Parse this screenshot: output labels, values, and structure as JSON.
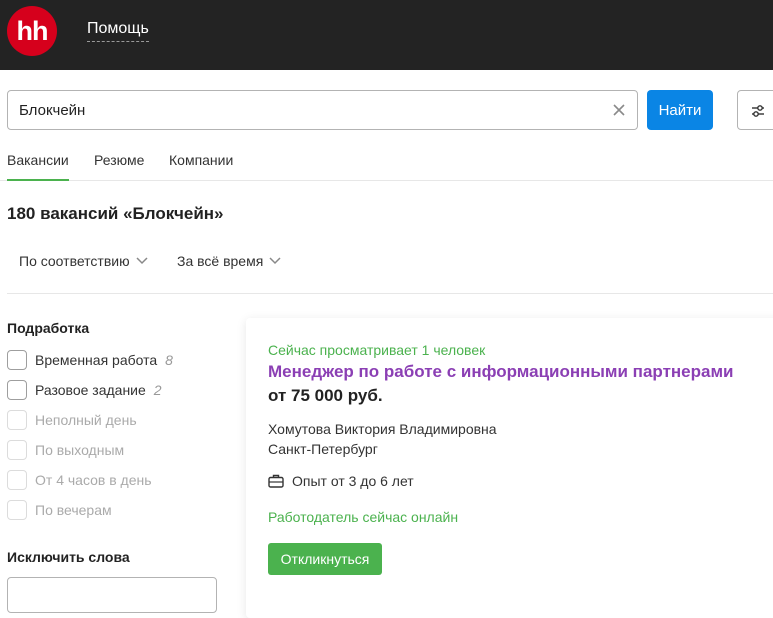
{
  "header": {
    "logo_text": "hh",
    "help_label": "Помощь"
  },
  "search": {
    "value": "Блокчейн",
    "button_label": "Найти"
  },
  "tabs": [
    {
      "label": "Вакансии",
      "active": true
    },
    {
      "label": "Резюме",
      "active": false
    },
    {
      "label": "Компании",
      "active": false
    }
  ],
  "results": {
    "title": "180 вакансий «Блокчейн»",
    "sort_label": "По соответствию",
    "period_label": "За всё время"
  },
  "sidebar": {
    "section_title": "Подработка",
    "options": [
      {
        "label": "Временная работа",
        "count": "8",
        "enabled": true
      },
      {
        "label": "Разовое задание",
        "count": "2",
        "enabled": true
      },
      {
        "label": "Неполный день",
        "count": "",
        "enabled": false
      },
      {
        "label": "По выходным",
        "count": "",
        "enabled": false
      },
      {
        "label": "От 4 часов в день",
        "count": "",
        "enabled": false
      },
      {
        "label": "По вечерам",
        "count": "",
        "enabled": false
      }
    ],
    "exclude_title": "Исключить слова"
  },
  "vacancy": {
    "viewing_now": "Сейчас просматривает 1 человек",
    "title": "Менеджер по работе с информационными партнерами",
    "salary": "от 75 000 руб.",
    "employer": "Хомутова Виктория Владимировна",
    "city": "Санкт-Петербург",
    "experience": "Опыт от 3 до 6 лет",
    "employer_online": "Работодатель сейчас онлайн",
    "apply_label": "Откликнуться"
  },
  "colors": {
    "header_bg": "#232323",
    "logo_red": "#d6001c",
    "primary_blue": "#0a85e5",
    "green": "#4bb24e",
    "vacancy_purple": "#8b3fb4"
  }
}
